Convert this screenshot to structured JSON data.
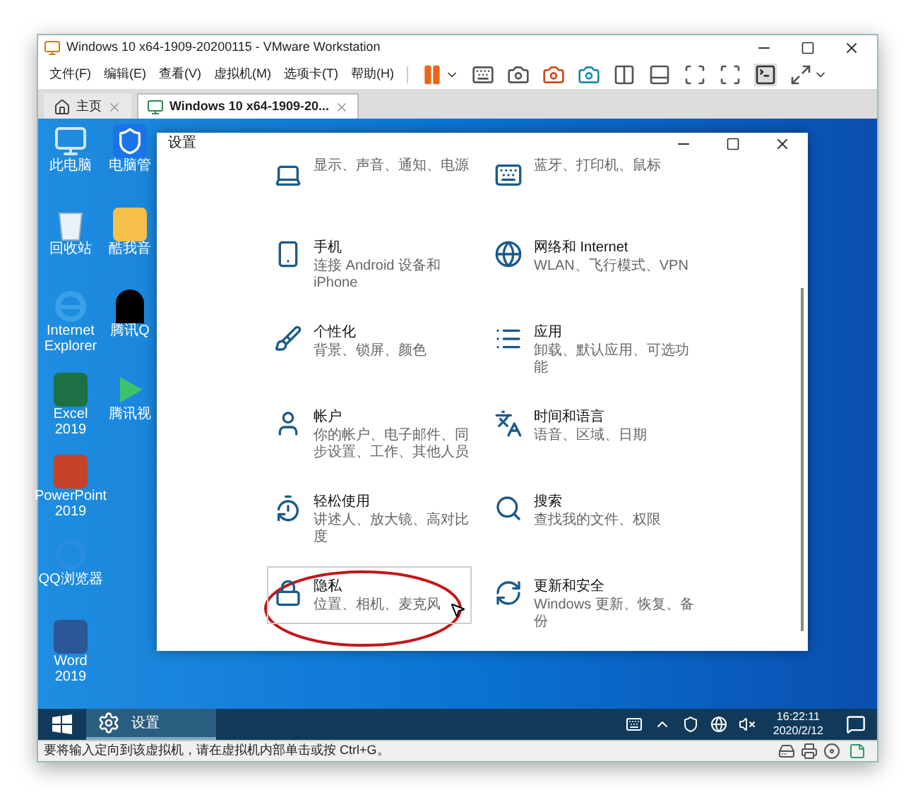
{
  "vmware": {
    "title": "Windows 10 x64-1909-20200115 - VMware Workstation",
    "menu": [
      "文件(F)",
      "编辑(E)",
      "查看(V)",
      "虚拟机(M)",
      "选项卡(T)",
      "帮助(H)"
    ],
    "tabs": [
      {
        "label": "主页",
        "selected": false
      },
      {
        "label": "Windows 10 x64-1909-20...",
        "selected": true
      }
    ]
  },
  "desktop": {
    "icons": [
      "此电脑",
      "回收站",
      "Internet Explorer",
      "Excel 2019",
      "PowerPoint 2019",
      "QQ浏览器",
      "Word 2019",
      "电脑管",
      "酷我音",
      "腾讯Q",
      "腾讯视"
    ]
  },
  "settings": {
    "title": "设置",
    "items": [
      {
        "subtitle": "显示、声音、通知、电源",
        "highlighted": false
      },
      {
        "subtitle": "蓝牙、打印机、鼠标",
        "highlighted": false
      },
      {
        "title": "手机",
        "subtitle": "连接 Android 设备和 iPhone",
        "highlighted": false
      },
      {
        "title": "网络和 Internet",
        "subtitle": "WLAN、飞行模式、VPN",
        "highlighted": false
      },
      {
        "title": "个性化",
        "subtitle": "背景、锁屏、颜色",
        "highlighted": false
      },
      {
        "title": "应用",
        "subtitle": "卸载、默认应用、可选功能",
        "highlighted": false
      },
      {
        "title": "帐户",
        "subtitle": "你的帐户、电子邮件、同步设置、工作、其他人员",
        "highlighted": false
      },
      {
        "title": "时间和语言",
        "subtitle": "语音、区域、日期",
        "highlighted": false
      },
      {
        "title": "轻松使用",
        "subtitle": "讲述人、放大镜、高对比度",
        "highlighted": false
      },
      {
        "title": "搜索",
        "subtitle": "查找我的文件、权限",
        "highlighted": false
      },
      {
        "title": "隐私",
        "subtitle": "位置、相机、麦克风",
        "highlighted": true
      },
      {
        "title": "更新和安全",
        "subtitle": "Windows 更新、恢复、备份",
        "highlighted": false
      }
    ]
  },
  "taskbar": {
    "apps": [
      {
        "label": "设置",
        "selected": true
      }
    ],
    "time": "16:22:11",
    "date": "2020/2/12"
  },
  "status_bar": "要将输入定向到该虚拟机，请在虚拟机内部单击或按 Ctrl+G。"
}
